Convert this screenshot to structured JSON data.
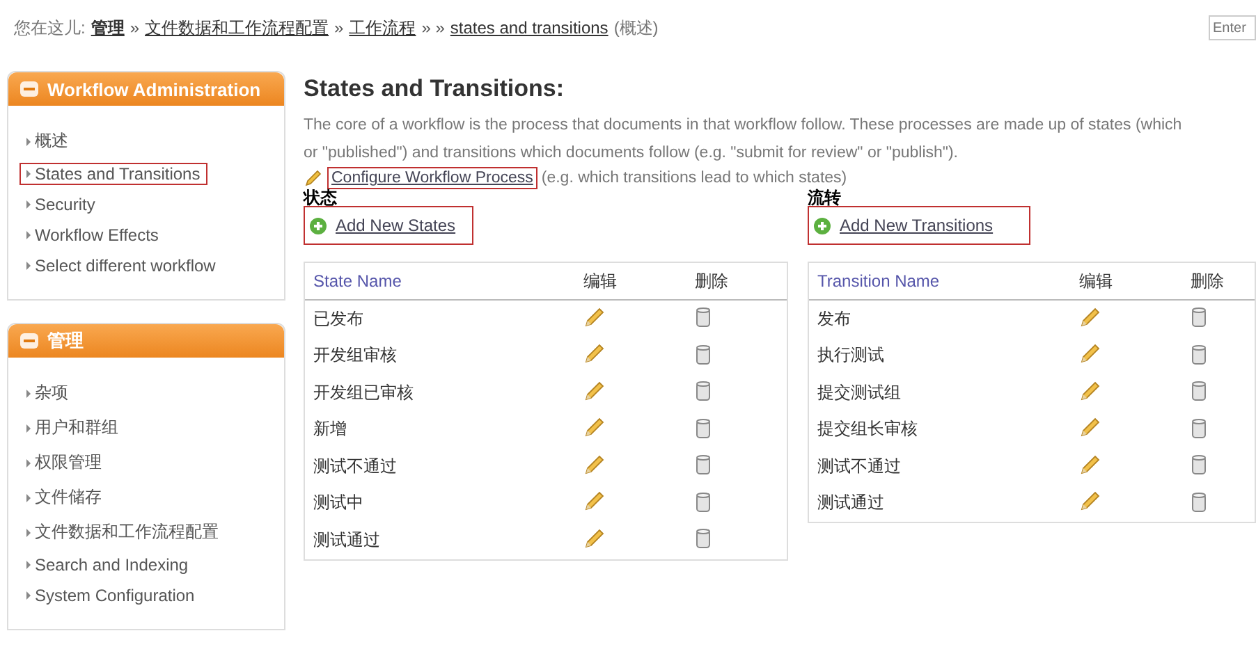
{
  "breadcrumb": {
    "prefix": "您在这儿:",
    "items": [
      {
        "label": "管理",
        "bold": true
      },
      {
        "label": "文件数据和工作流程配置",
        "bold": false
      },
      {
        "label": "工作流程",
        "bold": false
      },
      {
        "label": "states and transitions",
        "bold": false
      }
    ],
    "separators": [
      "»",
      "»",
      "» »"
    ],
    "suffix": "(概述)"
  },
  "search": {
    "placeholder": "Enter"
  },
  "sidebar": [
    {
      "title": "Workflow Administration",
      "items": [
        {
          "label": "概述",
          "highlighted": false
        },
        {
          "label": "States and Transitions",
          "highlighted": true
        },
        {
          "label": "Security",
          "highlighted": false
        },
        {
          "label": "Workflow Effects",
          "highlighted": false
        },
        {
          "label": "Select different workflow",
          "highlighted": false
        }
      ]
    },
    {
      "title": "管理",
      "items": [
        {
          "label": "杂项",
          "highlighted": false
        },
        {
          "label": "用户和群组",
          "highlighted": false
        },
        {
          "label": "权限管理",
          "highlighted": false
        },
        {
          "label": "文件储存",
          "highlighted": false
        },
        {
          "label": "文件数据和工作流程配置",
          "highlighted": false
        },
        {
          "label": "Search and Indexing",
          "highlighted": false
        },
        {
          "label": "System Configuration",
          "highlighted": false
        }
      ]
    }
  ],
  "main": {
    "title": "States and Transitions:",
    "description": [
      "The core of a workflow is the process that documents in that workflow follow. These processes are made up of states (which",
      "or \"published\") and transitions which documents follow (e.g. \"submit for review\" or \"publish\")."
    ],
    "configure_link": {
      "label": "Configure Workflow Process",
      "highlighted": true
    },
    "configure_note": "(e.g. which transitions lead to which states)",
    "sections": [
      {
        "heading": "状态",
        "add_button": {
          "label": "Add New States",
          "highlighted": true
        },
        "columns": [
          "State Name",
          "编辑",
          "删除"
        ],
        "rows": [
          "已发布",
          "开发组审核",
          "开发组已审核",
          "新增",
          "测试不通过",
          "测试中",
          "测试通过"
        ]
      },
      {
        "heading": "流转",
        "add_button": {
          "label": "Add New Transitions",
          "highlighted": true
        },
        "columns": [
          "Transition Name",
          "编辑",
          "删除"
        ],
        "rows": [
          "发布",
          "执行测试",
          "提交测试组",
          "提交组长审核",
          "测试不通过",
          "测试通过"
        ]
      }
    ]
  }
}
